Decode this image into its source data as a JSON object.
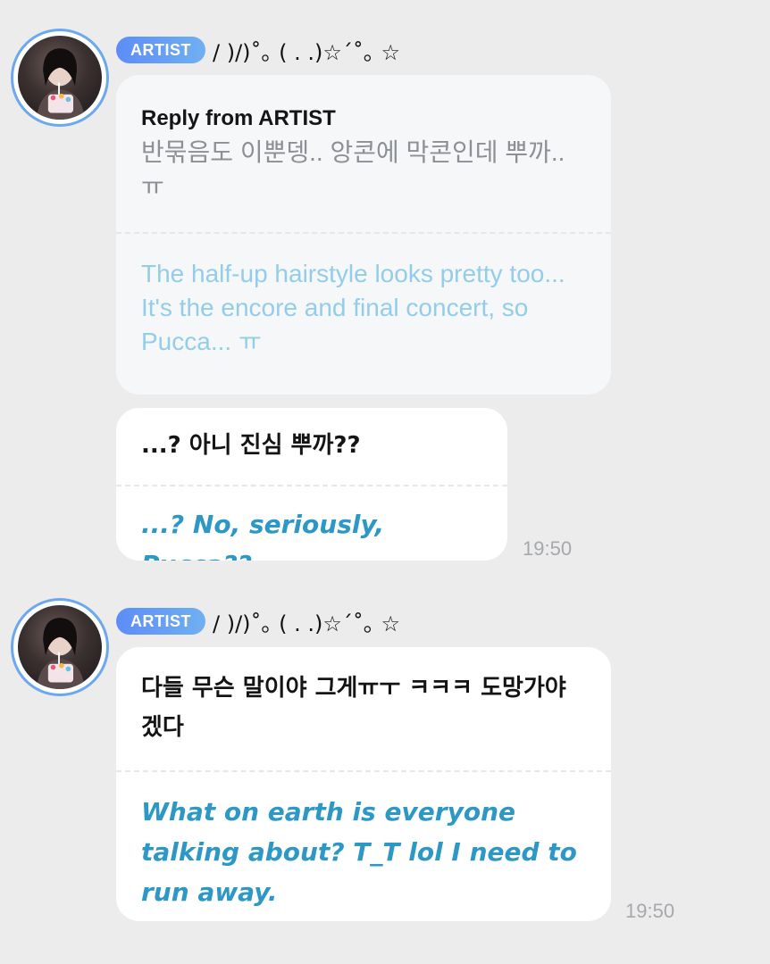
{
  "badge_label": "ARTIST",
  "artist_name": "/ )/)˚｡ ( . .)☆´˚｡ ☆",
  "messages": [
    {
      "reply_title": "Reply from ARTIST",
      "reply_original": "반묶음도 이뿐뎅.. 앙콘에 막콘인데 뿌까..ㅠ",
      "reply_translation": "The half-up hairstyle looks pretty too... It's the encore and final concert, so Pucca... ㅠ",
      "original": "...? 아니 진심 뿌까??",
      "translation": "...? No, seriously, Pucca??",
      "time": "19:50"
    },
    {
      "original": "다들 무슨 말이야 그게ㅠㅜ ㅋㅋㅋ 도망가야겠다",
      "translation": "What on earth is everyone talking about? T_T lol I need to run away.",
      "time": "19:50"
    }
  ],
  "colors": {
    "background": "#ececed",
    "avatar_ring": "#6ca8f0",
    "badge_gradient_start": "#5c8df5",
    "badge_gradient_end": "#6fb0f2",
    "reply_translation_text": "#93cde9",
    "translation_text": "#2d97c6",
    "time_text": "#a6a8ac"
  }
}
